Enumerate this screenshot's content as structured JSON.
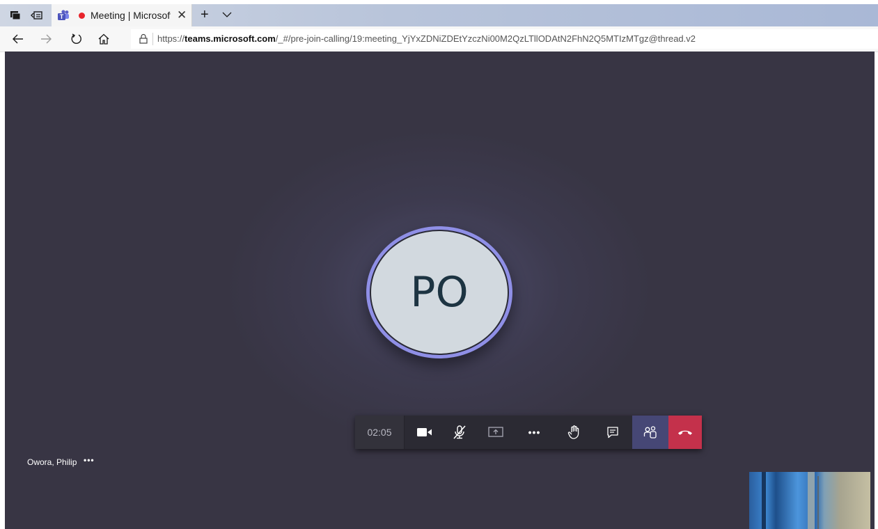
{
  "browser": {
    "tab": {
      "title": "Meeting | Microsoft Teams",
      "close_glyph": "✕",
      "icons": [
        "tab-actions-icon",
        "set-aside-tabs-icon",
        "teams-logo-icon",
        "recording-dot-icon"
      ]
    },
    "new_tab_glyph": "+",
    "address_bar": {
      "url_prefix": "https://",
      "url_host": "teams.microsoft.com",
      "url_path": "/_#/pre-join-calling/19:meeting_YjYxZDNiZDEtYzczNi00M2QzLTllODAtN2FhN2Q5MTIzMTgz@thread.v2"
    },
    "nav_icons": [
      "back-arrow-icon",
      "forward-arrow-icon",
      "refresh-icon",
      "home-icon",
      "lock-icon"
    ]
  },
  "meeting": {
    "avatar_initials": "PO",
    "timer": "02:05",
    "controls": [
      {
        "name": "camera-icon",
        "state": "on"
      },
      {
        "name": "mic-muted-icon",
        "state": "muted"
      },
      {
        "name": "share-screen-icon"
      },
      {
        "name": "more-actions-icon"
      },
      {
        "name": "raise-hand-icon"
      },
      {
        "name": "chat-icon"
      },
      {
        "name": "participants-icon",
        "state": "active"
      },
      {
        "name": "hang-up-icon"
      }
    ],
    "more_glyph": "•••",
    "participant_name": "Owora, Philip",
    "participant_more_glyph": "•••"
  },
  "colors": {
    "stage_background": "#383544",
    "avatar_ring": "#8f8fe6",
    "avatar_fill": "#d2d9df",
    "hangup": "#c4314b",
    "participants_active": "#464775",
    "recording_dot": "#e8242b"
  }
}
